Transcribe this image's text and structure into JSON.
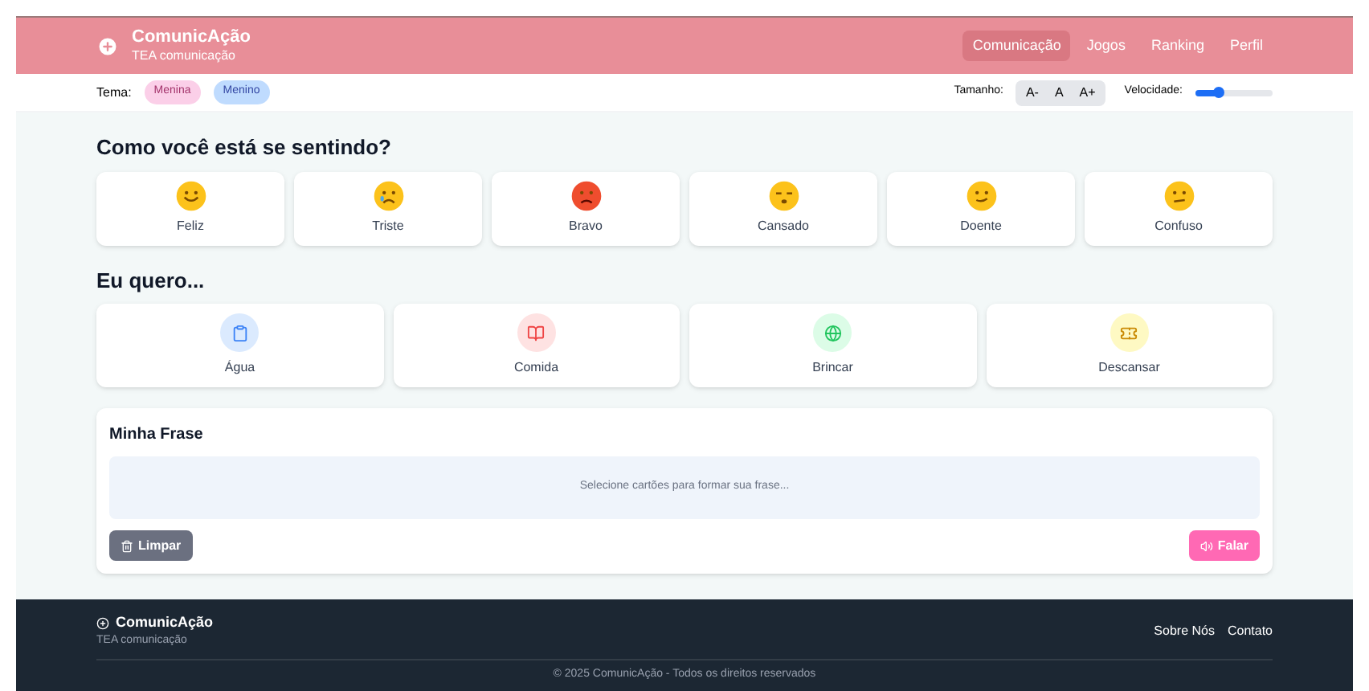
{
  "header": {
    "title": "ComunicAção",
    "subtitle": "TEA comunicação",
    "nav": [
      {
        "label": "Comunicação",
        "selected": true
      },
      {
        "label": "Jogos",
        "selected": false
      },
      {
        "label": "Ranking",
        "selected": false
      },
      {
        "label": "Perfil",
        "selected": false
      }
    ]
  },
  "toolbar": {
    "theme_label": "Tema:",
    "themes": [
      {
        "label": "Menina",
        "color": "#fbcfe8"
      },
      {
        "label": "Menino",
        "color": "#bfdbfe"
      }
    ],
    "size_label": "Tamanho:",
    "size_buttons": [
      "A-",
      "A",
      "A+"
    ],
    "speed_label": "Velocidade:",
    "speed": {
      "level": 0.3
    }
  },
  "feelings": {
    "title": "Como você está se sentindo?",
    "cards": [
      {
        "label": "Feliz",
        "kind": "happy"
      },
      {
        "label": "Triste",
        "kind": "sad"
      },
      {
        "label": "Bravo",
        "kind": "angry"
      },
      {
        "label": "Cansado",
        "kind": "tired"
      },
      {
        "label": "Doente",
        "kind": "sick"
      },
      {
        "label": "Confuso",
        "kind": "confused"
      }
    ]
  },
  "wants": {
    "title": "Eu quero...",
    "cards": [
      {
        "label": "Água",
        "kind": "clipboard",
        "color": "#dbeafe"
      },
      {
        "label": "Comida",
        "kind": "book",
        "color": "#fee2e2"
      },
      {
        "label": "Brincar",
        "kind": "globe",
        "color": "#dcfce7"
      },
      {
        "label": "Descansar",
        "kind": "ticket",
        "color": "#fef9c3"
      }
    ]
  },
  "phrase": {
    "title": "Minha Frase",
    "placeholder": "Selecione cartões para formar sua frase...",
    "clear_button": "Limpar",
    "speak_button": "Falar"
  },
  "footer": {
    "title": "ComunicAção",
    "subtitle": "TEA comunicação",
    "links": [
      "Sobre Nós",
      "Contato"
    ],
    "copyright": "© 2025 ComunicAção - Todos os direitos reservados"
  }
}
